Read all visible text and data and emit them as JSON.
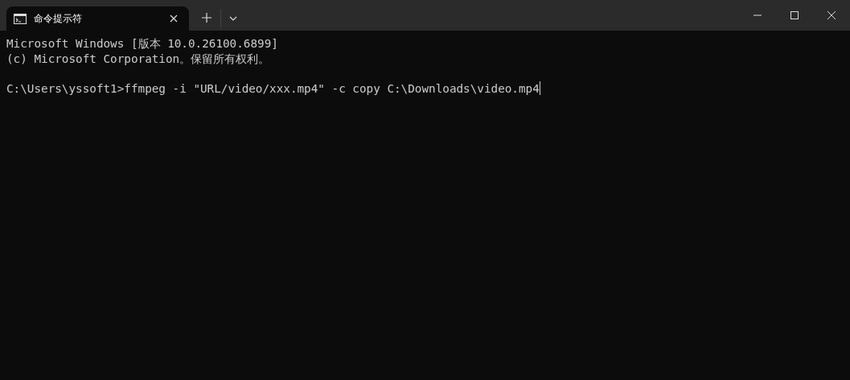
{
  "tabs": [
    {
      "title": "命令提示符",
      "selected": true
    }
  ],
  "terminal": {
    "banner": [
      "Microsoft Windows [版本 10.0.26100.6899]",
      "(c) Microsoft Corporation。保留所有权利。"
    ],
    "command_line": "C:\\Users\\yssoft1>ffmpeg -i \"URL/video/xxx.mp4\" -c copy C:\\Downloads\\video.mp4"
  }
}
